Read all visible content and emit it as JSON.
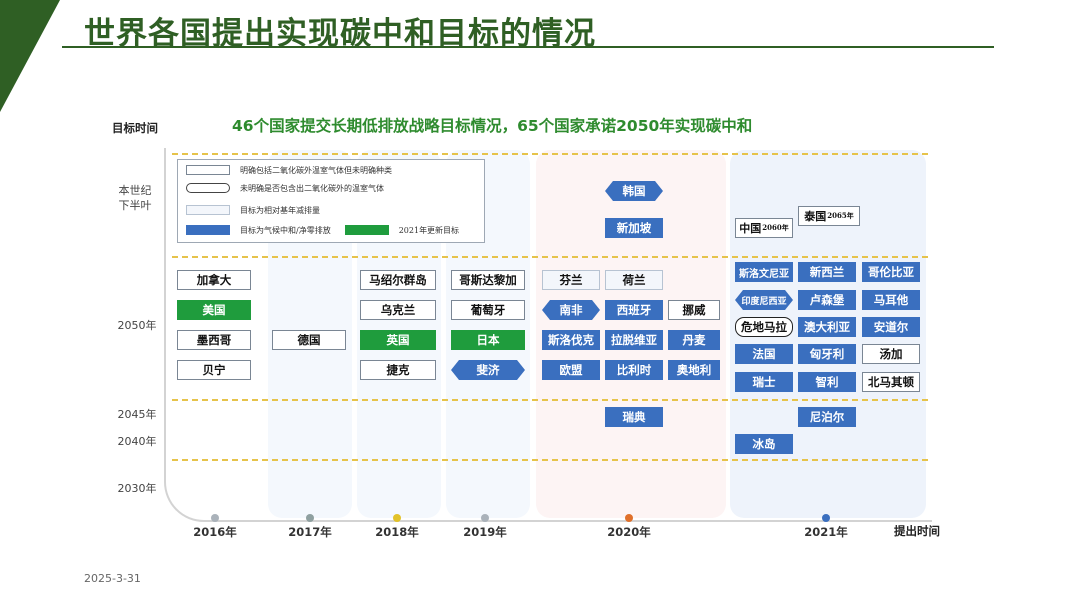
{
  "slide": {
    "title": "世界各国提出实现碳中和目标的情况",
    "subtitle": "46个国家提交长期低排放战略目标情况，65个国家承诺2050年实现碳中和",
    "date": "2025-3-31",
    "accent_color": "#2f5f24"
  },
  "axes": {
    "y_title": "目标时间",
    "x_title": "提出时间",
    "y_ticks": [
      "本世纪\n下半叶",
      "2050年",
      "2045年",
      "2040年",
      "2030年"
    ],
    "x_ticks": [
      "2016年",
      "2017年",
      "2018年",
      "2019年",
      "2020年",
      "2021年"
    ]
  },
  "legend": [
    {
      "label": "明确包括二氧化碳外温室气体但未明确种类",
      "style": "white"
    },
    {
      "label": "未明确是否包含出二氧化碳外的温室气体",
      "style": "hex-legend"
    },
    {
      "label": "目标为相对基年减排量",
      "style": "pale"
    },
    {
      "label": "目标为气候中和/净零排放",
      "style": "blue"
    },
    {
      "label": "2021年更新目标",
      "style": "green"
    }
  ],
  "colors": {
    "blue": "#3a6fbf",
    "green": "#1f9c3d",
    "dash": "#e6c34a"
  },
  "countries": {
    "c01": "加拿大",
    "c02": "美国",
    "c03": "墨西哥",
    "c04": "贝宁",
    "c05": "德国",
    "c06": "马绍尔群岛",
    "c07": "乌克兰",
    "c08": "英国",
    "c09": "捷克",
    "c10": "哥斯达黎加",
    "c11": "葡萄牙",
    "c12": "日本",
    "c13": "斐济",
    "c14": "韩国",
    "c15": "新加坡",
    "c16": "芬兰",
    "c17": "荷兰",
    "c18": "南非",
    "c19": "西班牙",
    "c20": "挪威",
    "c21": "斯洛伐克",
    "c22": "拉脱维亚",
    "c23": "丹麦",
    "c24": "欧盟",
    "c25": "比利时",
    "c26": "奥地利",
    "c27": "瑞典",
    "c28": "中国",
    "c28s": "2060年",
    "c29": "泰国",
    "c29s": "2065年",
    "c30": "斯洛文尼亚",
    "c31": "新西兰",
    "c32": "哥伦比亚",
    "c33": "印度尼西亚",
    "c34": "卢森堡",
    "c35": "马耳他",
    "c36": "危地马拉",
    "c37": "澳大利亚",
    "c38": "安道尔",
    "c39": "法国",
    "c40": "匈牙利",
    "c41": "汤加",
    "c42": "瑞士",
    "c43": "智利",
    "c44": "北马其顿",
    "c45": "尼泊尔",
    "c46": "冰岛"
  }
}
